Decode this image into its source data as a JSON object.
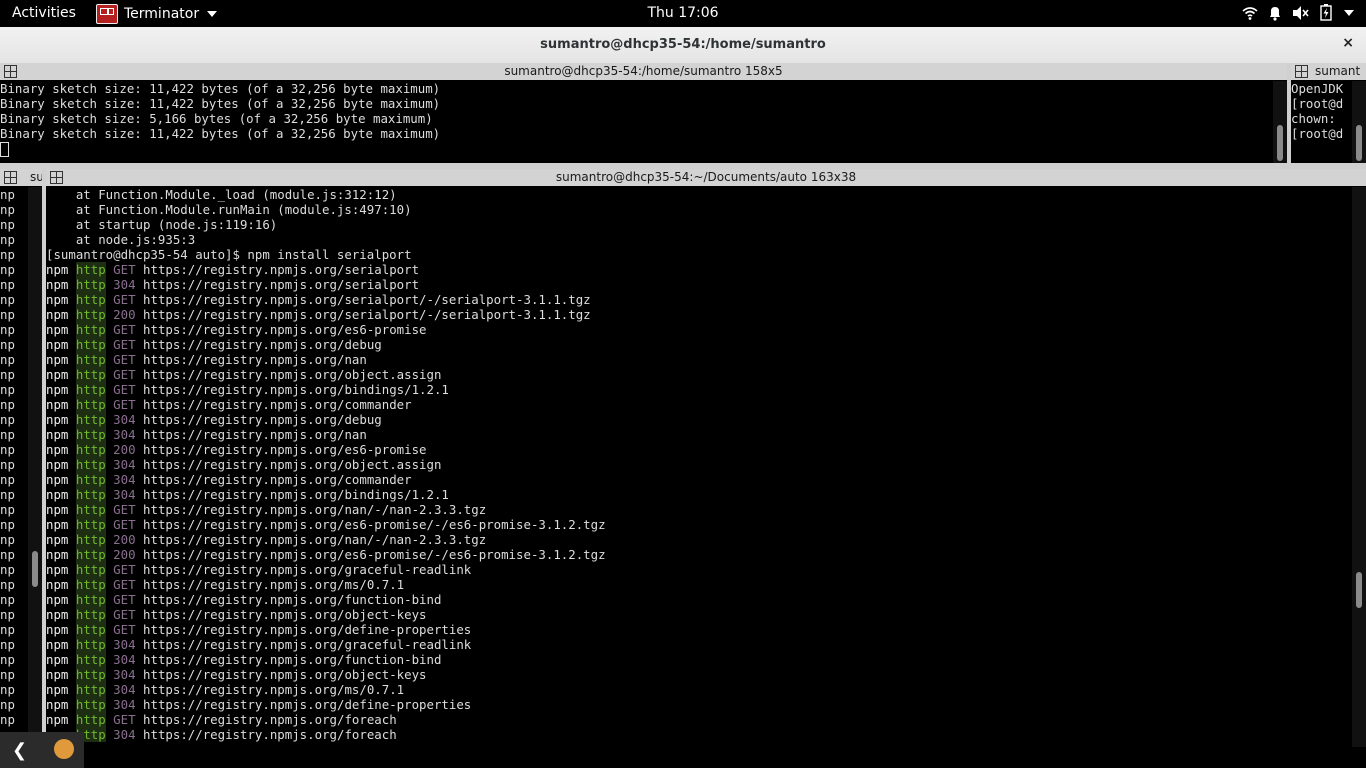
{
  "topbar": {
    "activities": "Activities",
    "app_name": "Terminator",
    "clock": "Thu 17:06",
    "tray_icons": [
      "wifi-icon",
      "notification-bell-icon",
      "volume-muted-icon",
      "battery-icon",
      "system-menu-caret-icon"
    ]
  },
  "window": {
    "title": "sumantro@dhcp35-54:/home/sumantro",
    "close_glyph": "×"
  },
  "pane_top_left": {
    "title": "sumantro@dhcp35-54:/home/sumantro 158x5",
    "lines": [
      "Binary sketch size: 11,422 bytes (of a 32,256 byte maximum)",
      "Binary sketch size: 11,422 bytes (of a 32,256 byte maximum)",
      "Binary sketch size: 5,166 bytes (of a 32,256 byte maximum)",
      "Binary sketch size: 11,422 bytes (of a 32,256 byte maximum)"
    ]
  },
  "pane_top_right": {
    "title": "sumant",
    "lines": [
      "OpenJDK",
      "[root@d",
      "chown:",
      "[root@d"
    ]
  },
  "pane_left_strip": {
    "title": "su",
    "row_text": "np"
  },
  "pane_main": {
    "title": "sumantro@dhcp35-54:~/Documents/auto 163x38",
    "pre_lines": [
      "    at Function.Module._load (module.js:312:12)",
      "    at Function.Module.runMain (module.js:497:10)",
      "    at startup (node.js:119:16)",
      "    at node.js:935:3",
      "[sumantro@dhcp35-54 auto]$ npm install serialport"
    ],
    "npm_lines": [
      {
        "method": "GET",
        "url": "https://registry.npmjs.org/serialport"
      },
      {
        "method": "304",
        "url": "https://registry.npmjs.org/serialport"
      },
      {
        "method": "GET",
        "url": "https://registry.npmjs.org/serialport/-/serialport-3.1.1.tgz"
      },
      {
        "method": "200",
        "url": "https://registry.npmjs.org/serialport/-/serialport-3.1.1.tgz"
      },
      {
        "method": "GET",
        "url": "https://registry.npmjs.org/es6-promise"
      },
      {
        "method": "GET",
        "url": "https://registry.npmjs.org/debug"
      },
      {
        "method": "GET",
        "url": "https://registry.npmjs.org/nan"
      },
      {
        "method": "GET",
        "url": "https://registry.npmjs.org/object.assign"
      },
      {
        "method": "GET",
        "url": "https://registry.npmjs.org/bindings/1.2.1"
      },
      {
        "method": "GET",
        "url": "https://registry.npmjs.org/commander"
      },
      {
        "method": "304",
        "url": "https://registry.npmjs.org/debug"
      },
      {
        "method": "304",
        "url": "https://registry.npmjs.org/nan"
      },
      {
        "method": "200",
        "url": "https://registry.npmjs.org/es6-promise"
      },
      {
        "method": "304",
        "url": "https://registry.npmjs.org/object.assign"
      },
      {
        "method": "304",
        "url": "https://registry.npmjs.org/commander"
      },
      {
        "method": "304",
        "url": "https://registry.npmjs.org/bindings/1.2.1"
      },
      {
        "method": "GET",
        "url": "https://registry.npmjs.org/nan/-/nan-2.3.3.tgz"
      },
      {
        "method": "GET",
        "url": "https://registry.npmjs.org/es6-promise/-/es6-promise-3.1.2.tgz"
      },
      {
        "method": "200",
        "url": "https://registry.npmjs.org/nan/-/nan-2.3.3.tgz"
      },
      {
        "method": "200",
        "url": "https://registry.npmjs.org/es6-promise/-/es6-promise-3.1.2.tgz"
      },
      {
        "method": "GET",
        "url": "https://registry.npmjs.org/graceful-readlink"
      },
      {
        "method": "GET",
        "url": "https://registry.npmjs.org/ms/0.7.1"
      },
      {
        "method": "GET",
        "url": "https://registry.npmjs.org/function-bind"
      },
      {
        "method": "GET",
        "url": "https://registry.npmjs.org/object-keys"
      },
      {
        "method": "GET",
        "url": "https://registry.npmjs.org/define-properties"
      },
      {
        "method": "304",
        "url": "https://registry.npmjs.org/graceful-readlink"
      },
      {
        "method": "304",
        "url": "https://registry.npmjs.org/function-bind"
      },
      {
        "method": "304",
        "url": "https://registry.npmjs.org/object-keys"
      },
      {
        "method": "304",
        "url": "https://registry.npmjs.org/ms/0.7.1"
      },
      {
        "method": "304",
        "url": "https://registry.npmjs.org/define-properties"
      },
      {
        "method": "GET",
        "url": "https://registry.npmjs.org/foreach"
      },
      {
        "method": "304",
        "url": "https://registry.npmjs.org/foreach"
      }
    ],
    "npm_label": "npm",
    "http_label": "http"
  },
  "colors": {
    "http_green": "#6fba2c",
    "method_purple": "#8a6f8f",
    "panel_title_bg": "#d3d3d3"
  }
}
